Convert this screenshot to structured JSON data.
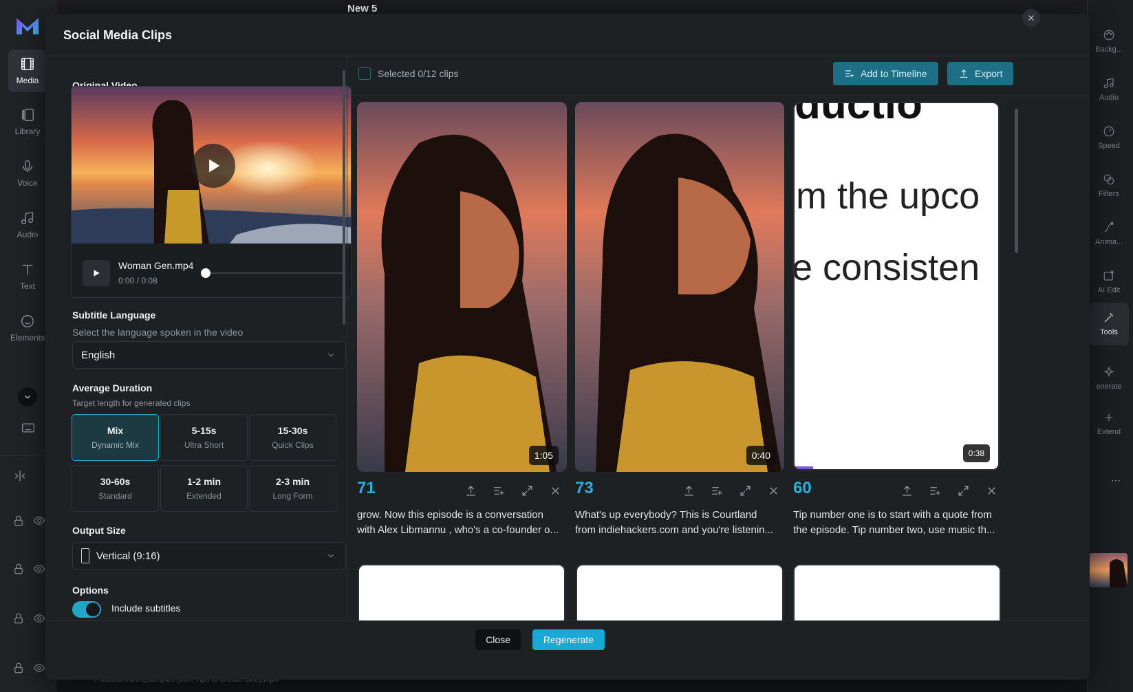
{
  "app": {
    "project_name": "New 5",
    "timeline_clip_label": "Podcast Intro Examples (Incl. Tips to Create One).mp4"
  },
  "left_rail": [
    {
      "label": "Media",
      "icon": "film-icon",
      "active": true
    },
    {
      "label": "Library",
      "icon": "library-icon"
    },
    {
      "label": "Voice",
      "icon": "microphone-icon"
    },
    {
      "label": "Audio",
      "icon": "music-note-icon"
    },
    {
      "label": "Text",
      "icon": "text-icon"
    },
    {
      "label": "Elements",
      "icon": "sticker-icon"
    }
  ],
  "right_rail": [
    {
      "label": "Backg...",
      "icon": "palette-icon"
    },
    {
      "label": "Audio",
      "icon": "music-note-icon"
    },
    {
      "label": "Speed",
      "icon": "speedometer-icon"
    },
    {
      "label": "Filters",
      "icon": "filter-icon"
    },
    {
      "label": "Anima...",
      "icon": "animation-icon"
    },
    {
      "label": "AI Edit",
      "icon": "ai-edit-icon"
    },
    {
      "label": "Tools",
      "icon": "magic-wand-icon",
      "active": true
    },
    {
      "label": "enerate",
      "icon": "sparkle-icon"
    },
    {
      "label": "Extend",
      "icon": "plus-icon"
    }
  ],
  "modal": {
    "title": "Social Media Clips",
    "original_video": {
      "heading": "Original Video",
      "file_name": "Woman Gen.mp4",
      "time": "0:00 / 0:08",
      "progress": 0.0
    },
    "subtitle_language": {
      "heading": "Subtitle Language",
      "hint": "Select the language spoken in the video",
      "value": "English"
    },
    "average_duration": {
      "heading": "Average Duration",
      "hint": "Target length for generated clips",
      "options": [
        {
          "title": "Mix",
          "desc": "Dynamic Mix",
          "selected": true
        },
        {
          "title": "5-15s",
          "desc": "Ultra Short"
        },
        {
          "title": "15-30s",
          "desc": "Quick Clips"
        },
        {
          "title": "30-60s",
          "desc": "Standard"
        },
        {
          "title": "1-2 min",
          "desc": "Extended"
        },
        {
          "title": "2-3 min",
          "desc": "Long Form"
        }
      ]
    },
    "output_size": {
      "heading": "Output Size",
      "value": "Vertical (9:16)"
    },
    "options": {
      "heading": "Options",
      "include_subtitles_label": "Include subtitles",
      "include_subtitles_on": true
    },
    "toolbar": {
      "selected_label": "Selected 0/12 clips",
      "add_to_timeline": "Add to Timeline",
      "export": "Export"
    },
    "clips": [
      {
        "score": "71",
        "duration": "1:05",
        "text_line1": "grow. Now this episode is a conversation",
        "text_line2": "with Alex  Libmannu , who's a co-founder o..."
      },
      {
        "score": "73",
        "duration": "0:40",
        "text_line1": "What's up everybody? This is Courtland",
        "text_line2": "from indiehackers.com and you're listenin..."
      },
      {
        "score": "60",
        "duration": "0:38",
        "text_line1": "Tip number one is to start with a quote from",
        "text_line2": "the episode. Tip number two, use music th...",
        "preview_lines": [
          "ductio",
          "m the upco",
          "e consisten"
        ],
        "progress": 0.09
      }
    ],
    "footer": {
      "close": "Close",
      "regenerate": "Regenerate"
    }
  },
  "colors": {
    "accent": "#1aa9d4",
    "score": "#28b0d8",
    "selected_border": "#26a6c6"
  }
}
